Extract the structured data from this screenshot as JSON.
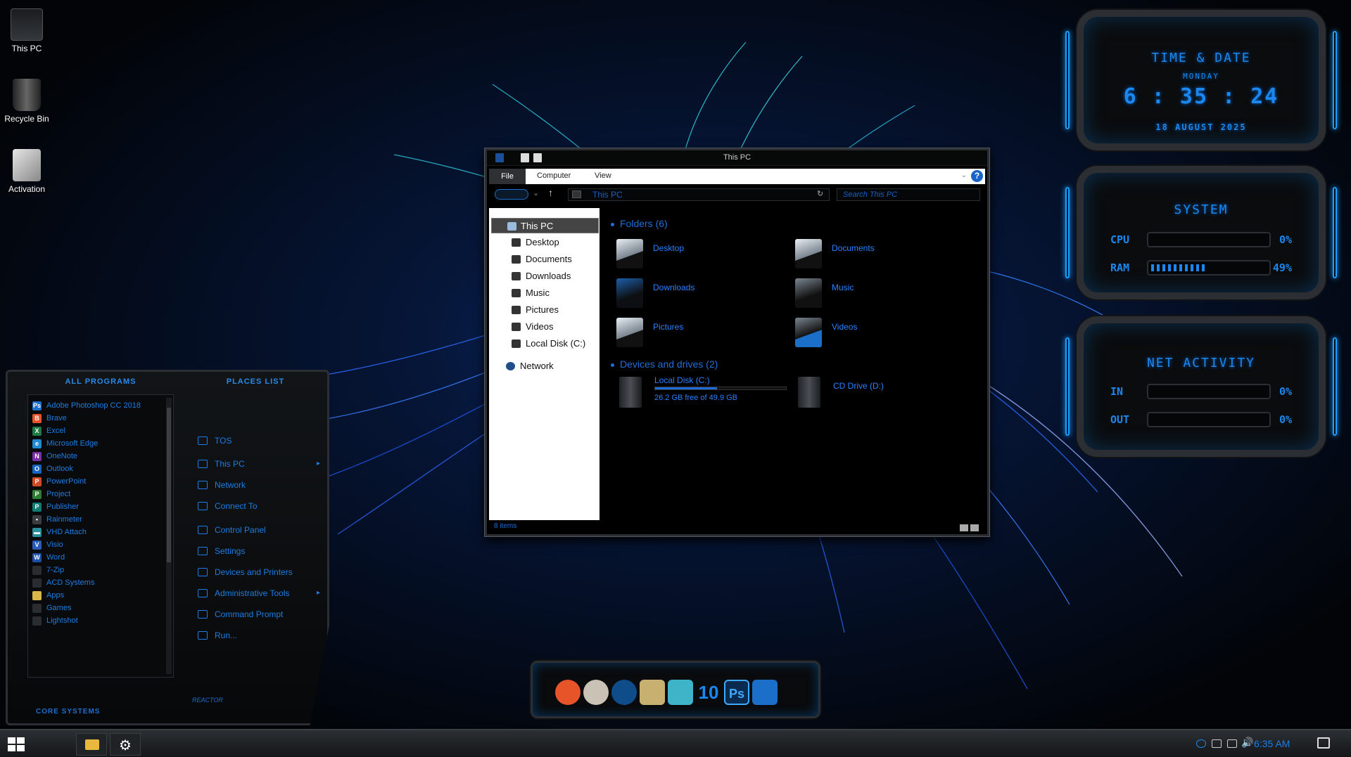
{
  "desktop": {
    "icons": [
      {
        "label": "This PC",
        "icon": "this-pc-icon"
      },
      {
        "label": "Recycle Bin",
        "icon": "recycle-bin-icon"
      },
      {
        "label": "Activation",
        "icon": "activation-icon"
      }
    ]
  },
  "explorer": {
    "title": "This PC",
    "ribbon_tabs": [
      "File",
      "Computer",
      "View"
    ],
    "help": "?",
    "address": "This PC",
    "search_placeholder": "Search This PC",
    "nav": [
      {
        "label": "This PC",
        "selected": true
      },
      {
        "label": "Desktop"
      },
      {
        "label": "Documents"
      },
      {
        "label": "Downloads"
      },
      {
        "label": "Music"
      },
      {
        "label": "Pictures"
      },
      {
        "label": "Videos"
      },
      {
        "label": "Local Disk (C:)"
      },
      {
        "label": "Network"
      }
    ],
    "folders_header": "Folders (6)",
    "folders": [
      "Desktop",
      "Documents",
      "Downloads",
      "Music",
      "Pictures",
      "Videos"
    ],
    "drives_header": "Devices and drives (2)",
    "drives": [
      {
        "label": "Local Disk (C:)",
        "free": "26.2 GB free of 49.9 GB",
        "used_fraction": 0.475
      },
      {
        "label": "CD Drive (D:)"
      }
    ],
    "status": "8 items"
  },
  "startmenu": {
    "all_programs": "ALL PROGRAMS",
    "places_list": "PLACES LIST",
    "programs": [
      {
        "label": "Adobe Photoshop CC 2018",
        "icon": "photoshop-icon",
        "glyph": "Ps",
        "color": "#1b6fc9"
      },
      {
        "label": "Brave",
        "icon": "brave-icon",
        "glyph": "B",
        "color": "#e8542a"
      },
      {
        "label": "Excel",
        "icon": "excel-icon",
        "glyph": "X",
        "color": "#1e7a45"
      },
      {
        "label": "Microsoft Edge",
        "icon": "edge-icon",
        "glyph": "e",
        "color": "#1f8ad2"
      },
      {
        "label": "OneNote",
        "icon": "onenote-icon",
        "glyph": "N",
        "color": "#7b2fa8"
      },
      {
        "label": "Outlook",
        "icon": "outlook-icon",
        "glyph": "O",
        "color": "#1565c0"
      },
      {
        "label": "PowerPoint",
        "icon": "powerpoint-icon",
        "glyph": "P",
        "color": "#d04a26"
      },
      {
        "label": "Project",
        "icon": "project-icon",
        "glyph": "P",
        "color": "#2e7d32"
      },
      {
        "label": "Publisher",
        "icon": "publisher-icon",
        "glyph": "P",
        "color": "#0f7b72"
      },
      {
        "label": "Rainmeter",
        "icon": "rainmeter-icon",
        "glyph": "•",
        "color": "#3a3d40"
      },
      {
        "label": "VHD Attach",
        "icon": "vhd-attach-icon",
        "glyph": "▬",
        "color": "#2a8d9c"
      },
      {
        "label": "Visio",
        "icon": "visio-icon",
        "glyph": "V",
        "color": "#2a5bb8"
      },
      {
        "label": "Word",
        "icon": "word-icon",
        "glyph": "W",
        "color": "#1e4fa8"
      },
      {
        "label": "7-Zip",
        "icon": "folder-icon",
        "glyph": "",
        "color": "#2a2d30"
      },
      {
        "label": "ACD Systems",
        "icon": "folder-icon",
        "glyph": "",
        "color": "#2a2d30"
      },
      {
        "label": "Apps",
        "icon": "apps-folder-icon",
        "glyph": "",
        "color": "#d8b64a"
      },
      {
        "label": "Games",
        "icon": "folder-icon",
        "glyph": "",
        "color": "#2a2d30"
      },
      {
        "label": "Lightshot",
        "icon": "folder-icon",
        "glyph": "",
        "color": "#2a2d30"
      }
    ],
    "places": [
      {
        "label": "TOS",
        "icon": "tos-icon",
        "arrow": ""
      },
      {
        "label": "This PC",
        "icon": "this-pc-icon",
        "arrow": "▸"
      },
      {
        "label": "Network",
        "icon": "network-icon",
        "arrow": ""
      },
      {
        "label": "Connect To",
        "icon": "connect-to-icon",
        "arrow": ""
      },
      {
        "label": "Control Panel",
        "icon": "control-panel-icon",
        "arrow": ""
      },
      {
        "label": "Settings",
        "icon": "settings-icon",
        "arrow": ""
      },
      {
        "label": "Devices and Printers",
        "icon": "printer-icon",
        "arrow": ""
      },
      {
        "label": "Administrative Tools",
        "icon": "admin-tools-icon",
        "arrow": "▸"
      },
      {
        "label": "Command Prompt",
        "icon": "command-prompt-icon",
        "arrow": ""
      },
      {
        "label": "Run...",
        "icon": "run-icon",
        "arrow": ""
      }
    ],
    "footer": "CORE SYSTEMS",
    "badge": "REACTOR"
  },
  "widgets": {
    "time": {
      "title": "TIME & DATE",
      "day": "MONDAY",
      "time": "6 : 35 : 24",
      "date": "18 AUGUST 2025"
    },
    "system": {
      "title": "SYSTEM",
      "rows": [
        {
          "label": "CPU",
          "value": "0%",
          "fraction": 0
        },
        {
          "label": "RAM",
          "value": "49%",
          "fraction": 0.49
        }
      ]
    },
    "net": {
      "title": "NET ACTIVITY",
      "rows": [
        {
          "label": "IN",
          "value": "0%",
          "fraction": 0
        },
        {
          "label": "OUT",
          "value": "0%",
          "fraction": 0
        }
      ]
    }
  },
  "dock": [
    {
      "name": "brave-dock-icon",
      "label": "",
      "color": "#e8542a"
    },
    {
      "name": "disc-burner-dock-icon",
      "label": "",
      "color": "#c9c2b5"
    },
    {
      "name": "dots-app-dock-icon",
      "label": "",
      "color": "#0e4c8a"
    },
    {
      "name": "drive-tool-dock-icon",
      "label": "",
      "color": "#c8b070"
    },
    {
      "name": "vhd-dock-icon",
      "label": "",
      "color": "#3fb3c8"
    },
    {
      "name": "windows10-dock-icon",
      "label": "10",
      "color": "#1b88ef"
    },
    {
      "name": "photoshop-dock-icon",
      "label": "Ps",
      "color": "#0b2a50"
    },
    {
      "name": "camera-dock-icon",
      "label": "",
      "color": "#1b6fc9"
    }
  ],
  "taskbar": {
    "clock": "6:35 AM"
  },
  "colors": {
    "accent": "#1b88ef",
    "explorer_link": "#2a80ff"
  }
}
